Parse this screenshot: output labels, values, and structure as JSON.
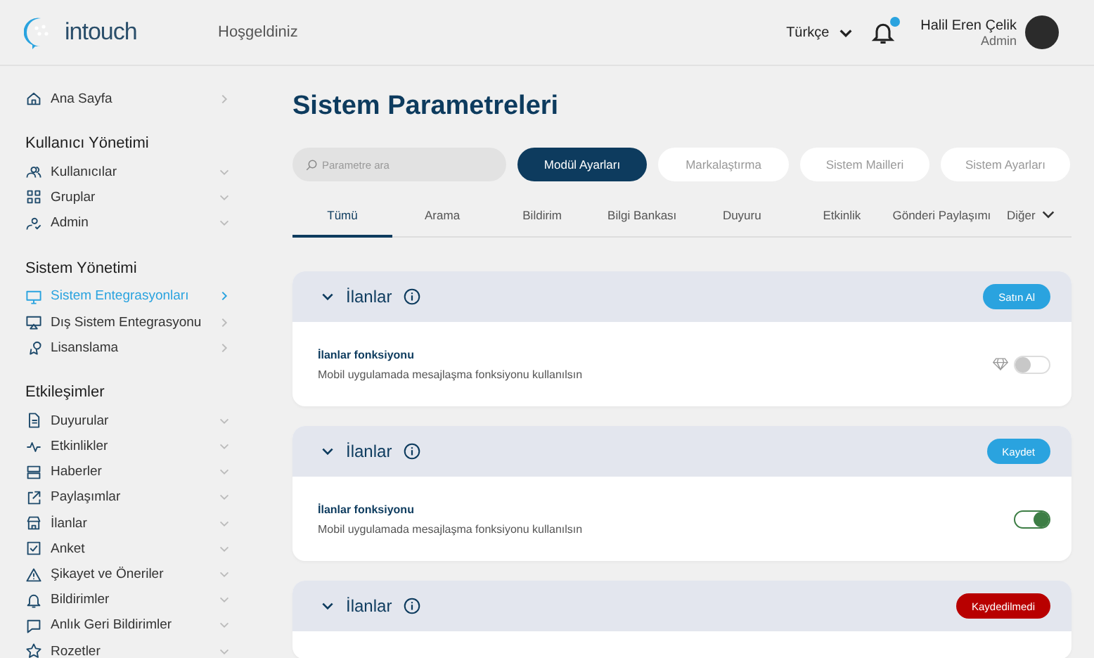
{
  "header": {
    "brand": "intouch",
    "welcome": "Hoşgeldiniz",
    "language": "Türkçe",
    "notification_dot": true,
    "user": {
      "name": "Halil Eren Çelik",
      "role": "Admin"
    }
  },
  "sidebar": {
    "sections": [
      {
        "items": [
          {
            "label": "Ana Sayfa",
            "kind": "link",
            "selected": false
          }
        ]
      },
      {
        "title": "Kullanıcı Yönetimi",
        "items": [
          {
            "label": "Kullanıcılar",
            "kind": "group",
            "selected": false
          },
          {
            "label": "Gruplar",
            "kind": "group",
            "selected": false
          },
          {
            "label": "Admin",
            "kind": "group",
            "selected": false
          }
        ]
      },
      {
        "title": "Sistem Yönetimi",
        "items": [
          {
            "label": "Sistem Entegrasyonları",
            "kind": "link",
            "selected": true
          },
          {
            "label": "Dış Sistem Entegrasyonu",
            "kind": "link",
            "selected": false
          },
          {
            "label": "Lisanslama",
            "kind": "link",
            "selected": false
          }
        ]
      },
      {
        "title": "Etkileşimler",
        "items": [
          {
            "label": "Duyurular",
            "kind": "group",
            "selected": false
          },
          {
            "label": "Etkinlikler",
            "kind": "group",
            "selected": false
          },
          {
            "label": "Haberler",
            "kind": "group",
            "selected": false
          },
          {
            "label": "Paylaşımlar",
            "kind": "group",
            "selected": false
          },
          {
            "label": "İlanlar",
            "kind": "group",
            "selected": false
          },
          {
            "label": "Anket",
            "kind": "group",
            "selected": false
          },
          {
            "label": "Şikayet ve Öneriler",
            "kind": "group",
            "selected": false
          },
          {
            "label": "Bildirimler",
            "kind": "group",
            "selected": false
          },
          {
            "label": "Anlık Geri Bildirimler",
            "kind": "group",
            "selected": false
          },
          {
            "label": "Rozetler",
            "kind": "group",
            "selected": false
          }
        ]
      }
    ]
  },
  "page_title": "Sistem Parametreleri",
  "search": {
    "placeholder": "Parametre ara"
  },
  "pills": [
    {
      "label": "Modül Ayarları",
      "selected": true
    },
    {
      "label": "Markalaştırma",
      "selected": false
    },
    {
      "label": "Sistem Mailleri",
      "selected": false
    },
    {
      "label": "Sistem Ayarları",
      "selected": false
    }
  ],
  "tabs": [
    {
      "label": "Tümü",
      "selected": true
    },
    {
      "label": "Arama",
      "selected": false
    },
    {
      "label": "Bildirim",
      "selected": false
    },
    {
      "label": "Bilgi Bankası",
      "selected": false
    },
    {
      "label": "Duyuru",
      "selected": false
    },
    {
      "label": "Etkinlik",
      "selected": false
    },
    {
      "label": "Gönderi Paylaşımı",
      "selected": false
    }
  ],
  "more_tab": "Diğer",
  "cards": [
    {
      "title": "İlanlar",
      "button": {
        "label": "Satın Al",
        "color": "#2aa3df"
      },
      "setting": {
        "title": "İlanlar fonksiyonu",
        "description": "Mobil uygulamada mesajlaşma fonksiyonu kullanılsın",
        "premium": true,
        "on": false
      }
    },
    {
      "title": "İlanlar",
      "button": {
        "label": "Kaydet",
        "color": "#2aa3df"
      },
      "setting": {
        "title": "İlanlar fonksiyonu",
        "description": "Mobil uygulamada mesajlaşma fonksiyonu kullanılsın",
        "premium": false,
        "on": true
      }
    },
    {
      "title": "İlanlar",
      "button": {
        "label": "Kaydedilmedi",
        "color": "#b80000"
      }
    }
  ]
}
